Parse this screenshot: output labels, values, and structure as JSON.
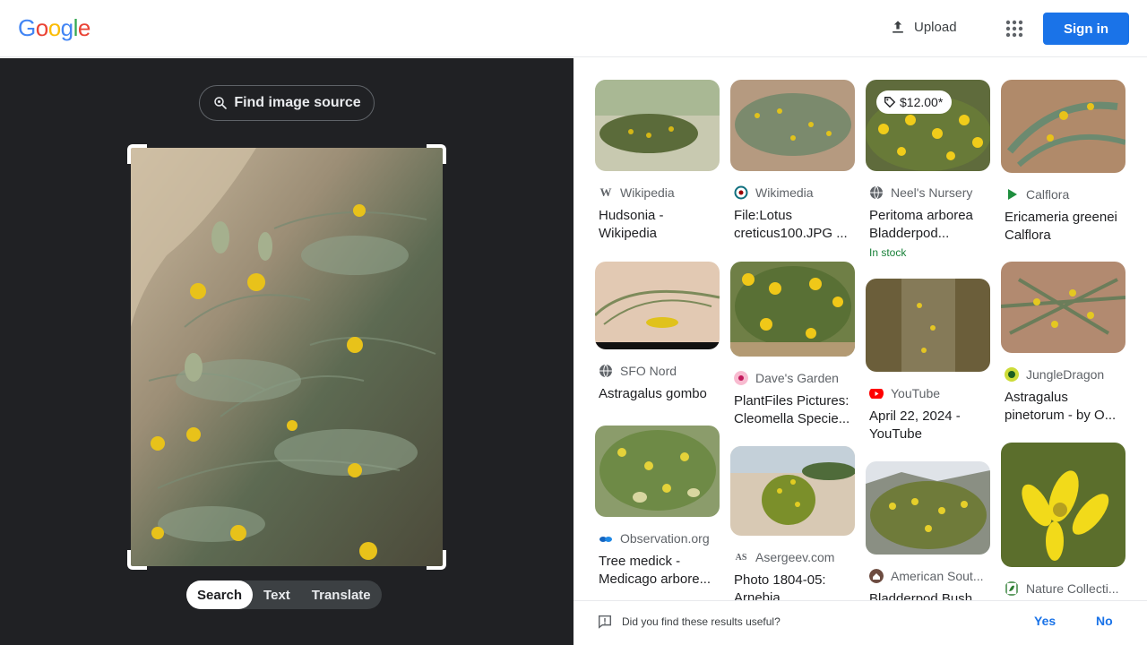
{
  "header": {
    "logo": "Google",
    "upload_label": "Upload",
    "signin_label": "Sign in"
  },
  "left": {
    "find_source_label": "Find image source",
    "modes": [
      "Search",
      "Text",
      "Translate"
    ],
    "active_mode": "Search"
  },
  "results": [
    {
      "source": "Wikipedia",
      "title": "Hudsonia - Wikipedia",
      "favicon": "W",
      "fav_color": "#202124",
      "fav_bg": "#fff"
    },
    {
      "source": "Wikimedia",
      "title": "File:Lotus creticus100.JPG ...",
      "favicon": "globe-icon",
      "fav_color": "#0f6f7e",
      "fav_bg": "#fff"
    },
    {
      "source": "Neel's Nursery",
      "title": "Peritoma arborea Bladderpod...",
      "favicon": "globe-icon",
      "fav_color": "#5f6368",
      "fav_bg": "#fff",
      "price": "$12.00*",
      "stock": "In stock"
    },
    {
      "source": "Calflora",
      "title": "Ericameria greenei Calflora",
      "favicon": "play-icon",
      "fav_color": "#1e8e3e",
      "fav_bg": "#fff"
    },
    {
      "source": "SFO Nord",
      "title": "Astragalus gombo",
      "favicon": "globe-icon",
      "fav_color": "#5f6368",
      "fav_bg": "#fff"
    },
    {
      "source": "Dave's Garden",
      "title": "PlantFiles Pictures: Cleomella Specie...",
      "favicon": "flower-icon",
      "fav_color": "#c2185b",
      "fav_bg": "#f8bbd0"
    },
    {
      "source": "YouTube",
      "title": "April 22, 2024 - YouTube",
      "favicon": "youtube-icon",
      "fav_color": "#fff",
      "fav_bg": "#ff0000"
    },
    {
      "source": "JungleDragon",
      "title": "Astragalus pinetorum - by O...",
      "favicon": "dragon-icon",
      "fav_color": "#1b5e20",
      "fav_bg": "#cddc39"
    },
    {
      "source": "Observation.org",
      "title": "Tree medick - Medicago arbore...",
      "favicon": "observation-icon",
      "fav_color": "#1565c0",
      "fav_bg": "#fff"
    },
    {
      "source": "Asergeev.com",
      "title": "Photo 1804-05: Arnebia",
      "favicon": "AS",
      "fav_color": "#202124",
      "fav_bg": "#fff"
    },
    {
      "source": "American Sout...",
      "title": "Bladderpod Bush,",
      "favicon": "house-icon",
      "fav_color": "#fff",
      "fav_bg": "#6d4c41"
    },
    {
      "source": "Nature Collecti...",
      "title": "",
      "favicon": "leaf-icon",
      "fav_color": "#2e7d32",
      "fav_bg": "#fff"
    }
  ],
  "feedback": {
    "question": "Did you find these results useful?",
    "yes": "Yes",
    "no": "No"
  },
  "colors": {
    "accent": "#1a73e8",
    "dark_panel": "#202124",
    "in_stock": "#188038"
  }
}
